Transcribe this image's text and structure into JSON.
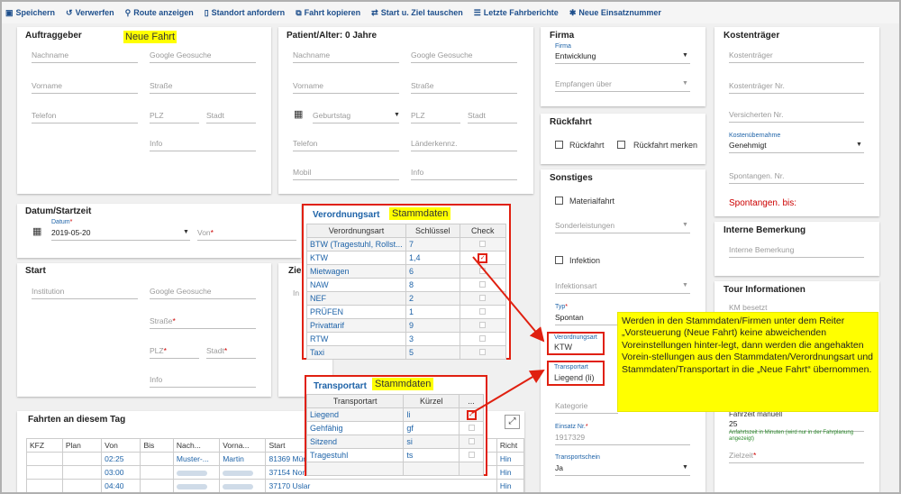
{
  "toolbar": {
    "save": "Speichern",
    "discard": "Verwerfen",
    "route": "Route anzeigen",
    "location": "Standort anfordern",
    "copy": "Fahrt kopieren",
    "swap": "Start u. Ziel tauschen",
    "last": "Letzte Fahrberichte",
    "newnum": "Neue Einsatznummer"
  },
  "auftraggeber": {
    "title": "Auftraggeber",
    "badge": "Neue Fahrt",
    "nachname": "Nachname",
    "geosuche": "Google Geosuche",
    "vorname": "Vorname",
    "strasse": "Straße",
    "telefon": "Telefon",
    "plz": "PLZ",
    "stadt": "Stadt",
    "info": "Info"
  },
  "patient": {
    "title": "Patient/Alter: 0 Jahre",
    "nachname": "Nachname",
    "geosuche": "Google Geosuche",
    "vorname": "Vorname",
    "strasse": "Straße",
    "geburtstag": "Geburtstag",
    "plz": "PLZ",
    "stadt": "Stadt",
    "telefon": "Telefon",
    "laender": "Länderkennz.",
    "mobil": "Mobil",
    "info": "Info"
  },
  "firma": {
    "title": "Firma",
    "firma_label": "Firma",
    "firma_value": "Entwicklung",
    "empfangen": "Empfangen über"
  },
  "rueckfahrt": {
    "title": "Rückfahrt",
    "rueckfahrt": "Rückfahrt",
    "merken": "Rückfahrt merken"
  },
  "sonstiges": {
    "title": "Sonstiges",
    "materialfahrt": "Materialfahrt",
    "sonderleistungen": "Sonderleistungen",
    "infektion": "Infektion",
    "infektionsart": "Infektionsart",
    "typ_label": "Typ",
    "typ_value": "Spontan",
    "verordnungsart_label": "Verordnungsart",
    "verordnungsart_value": "KTW",
    "transportart_label": "Transportart",
    "transportart_value": "Liegend (li)",
    "kategorie": "Kategorie",
    "einsatz_label": "Einsatz Nr.",
    "einsatz_value": "1917329",
    "transportschein_label": "Transportschein",
    "transportschein_value": "Ja"
  },
  "kostentraeger": {
    "title": "Kostenträger",
    "kt": "Kostenträger",
    "ktnr": "Kostenträger Nr.",
    "versicherten": "Versicherten Nr.",
    "kostenuebernahme_label": "Kostenübernahme",
    "kostenuebernahme_value": "Genehmigt",
    "spontangen": "Spontangen. Nr.",
    "spontangen_bis": "Spontangen. bis:"
  },
  "interne": {
    "title": "Interne Bemerkung",
    "placeholder": "Interne Bemerkung"
  },
  "tour": {
    "title": "Tour Informationen",
    "km": "KM besetzt",
    "fahrzeit_label": "Fahrzeit manuell",
    "fahrzeit_value": "25",
    "fahrzeit_hint": "Anfahrtszeit in Minuten (wird nur in der Fahrplanung angezeigt)",
    "zielzeit": "Zielzeit"
  },
  "datum": {
    "title": "Datum/Startzeit",
    "label": "Datum",
    "value": "2019-05-20",
    "von": "Von"
  },
  "start": {
    "title": "Start",
    "ziel_stub": "Zie",
    "institution": "Institution",
    "geosuche": "Google Geosuche",
    "strasse": "Straße",
    "plz": "PLZ",
    "stadt": "Stadt",
    "info": "Info",
    "in_stub": "In"
  },
  "verordnung": {
    "title": "Verordnungsart",
    "badge": "Stammdaten",
    "headers": [
      "Verordnungsart",
      "Schlüssel",
      "Check"
    ],
    "rows": [
      [
        "BTW (Tragestuhl, Rollst...",
        "7"
      ],
      [
        "KTW",
        "1,4"
      ],
      [
        "Mietwagen",
        "6"
      ],
      [
        "NAW",
        "8"
      ],
      [
        "NEF",
        "2"
      ],
      [
        "PRÜFEN",
        "1"
      ],
      [
        "Privattarif",
        "9"
      ],
      [
        "RTW",
        "3"
      ],
      [
        "Taxi",
        "5"
      ]
    ],
    "checked_index": 1
  },
  "transport": {
    "title": "Transportart",
    "badge": "Stammdaten",
    "headers": [
      "Transportart",
      "Kürzel",
      "..."
    ],
    "rows": [
      [
        "Liegend",
        "li"
      ],
      [
        "Gehfähig",
        "gf"
      ],
      [
        "Sitzend",
        "si"
      ],
      [
        "Tragestuhl",
        "ts"
      ]
    ],
    "checked_index": 0
  },
  "fahrten": {
    "title": "Fahrten an diesem Tag",
    "headers": [
      "KFZ",
      "Plan",
      "Von",
      "Bis",
      "Nach...",
      "Vorna...",
      "Start",
      "Richt"
    ],
    "rows": [
      {
        "von": "02:25",
        "nach": "Muster-...",
        "vorname": "Martin",
        "start": "81369 Münche",
        "richt": "Hin"
      },
      {
        "von": "03:00",
        "nach": "",
        "vorname": "",
        "start": "37154 Northei",
        "richt": "Hin"
      },
      {
        "von": "04:40",
        "nach": "",
        "vorname": "",
        "start": "37170 Uslar",
        "richt": "Hin"
      }
    ]
  },
  "note": "Werden in den Stammdaten/Firmen unter dem Reiter „Vorsteuerung (Neue Fahrt) keine abweichenden Voreinstellungen hinter-legt, dann werden die angehakten Vorein-stellungen aus den Stammdaten/Verordnungsart und Stammdaten/Transportart in die „Neue Fahrt“ übernommen.",
  "colors": {
    "accent": "#1e4f8c",
    "highlight": "#ffff00",
    "annotation": "#e02010",
    "required": "#cc0000"
  }
}
